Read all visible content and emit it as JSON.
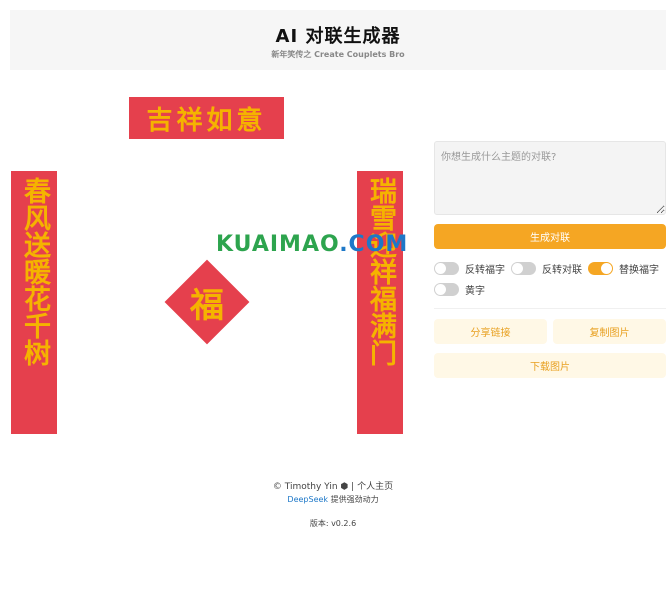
{
  "header": {
    "title": "AI 对联生成器",
    "subtitle": "新年笑传之 Create Couplets Bro"
  },
  "couplet": {
    "horizontal": "吉祥如意",
    "left": "春风送暖花千树",
    "right": "瑞雪迎祥福满门",
    "fu": "福"
  },
  "watermark": {
    "part1": "KUAIMAO",
    "part2": ".COM"
  },
  "panel": {
    "placeholder": "你想生成什么主题的对联?",
    "generate_label": "生成对联",
    "toggles": [
      {
        "label": "反转福字",
        "on": false
      },
      {
        "label": "反转对联",
        "on": false
      },
      {
        "label": "替换福字",
        "on": true
      },
      {
        "label": "黄字",
        "on": false
      }
    ],
    "share_label": "分享链接",
    "copy_label": "复制图片",
    "download_label": "下载图片"
  },
  "footer": {
    "author": "© Timothy Yin",
    "separator": "|",
    "homepage": "个人主页",
    "deepseek": "DeepSeek",
    "powered": " 提供强劲动力",
    "version": "版本: v0.2.6"
  },
  "colors": {
    "couplet_red": "#e5404d",
    "text_gold": "#f5b300",
    "accent_orange": "#f5a623"
  }
}
